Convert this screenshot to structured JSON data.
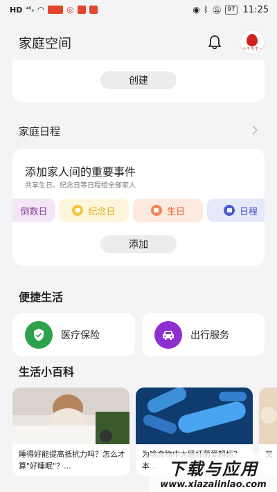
{
  "status_bar": {
    "signal": "⁴⁶ᵢₗ",
    "battery": "97",
    "time": "11:25"
  },
  "header": {
    "title": "家庭空间",
    "bell_icon": "bell-icon",
    "avatar_caption": "小 子 先 生 ~"
  },
  "top_card": {
    "create_label": "创建"
  },
  "schedule": {
    "title": "家庭日程",
    "event_title": "添加家人间的重要事件",
    "event_subtitle": "共享生日、纪念日等日程给全部家人",
    "chips": [
      {
        "label": "倒数日",
        "bg": "#f3e7f5",
        "color": "#8a3d97"
      },
      {
        "label": "纪念日",
        "bg": "#fdf6dd",
        "color": "#e0a51a"
      },
      {
        "label": "生日",
        "bg": "#fde9df",
        "color": "#e0632f"
      },
      {
        "label": "日程",
        "bg": "#e6e9fa",
        "color": "#3f4cc2"
      }
    ],
    "add_label": "添加"
  },
  "quick_life": {
    "title": "便捷生活",
    "services": [
      {
        "label": "医疗保险",
        "color": "#2ba24b",
        "icon": "shield-icon"
      },
      {
        "label": "出行服务",
        "color": "#8f2fd2",
        "icon": "car-icon"
      }
    ]
  },
  "wiki": {
    "title": "生活小百科",
    "articles": [
      {
        "text": "睡得好能提高抵抗力吗？怎么才算\"好睡眠\"？..."
      },
      {
        "text": "为啥食物中大肠杆菌爱超标？本..."
      },
      {
        "text": "叉..."
      }
    ]
  },
  "watermark": {
    "main": "下载与应用",
    "url": "www.xiazaiinlao.com"
  }
}
